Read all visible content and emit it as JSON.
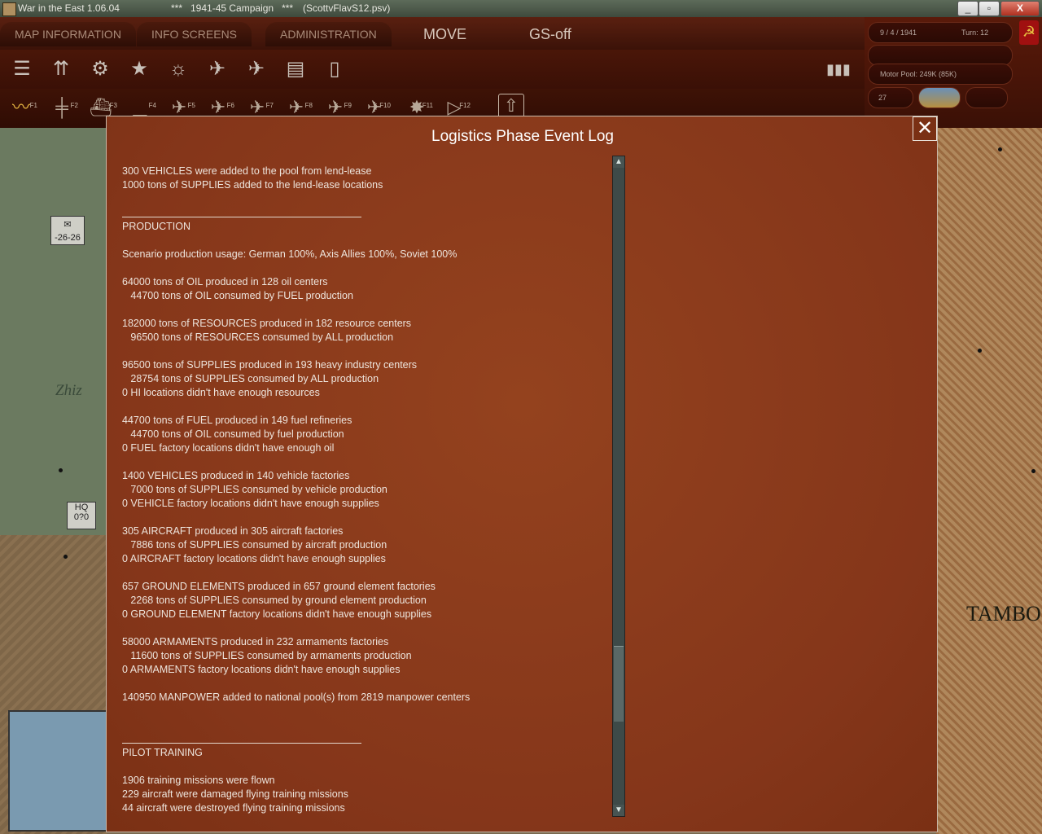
{
  "window": {
    "app_title": "War in the East 1.06.04",
    "campaign": "***   1941-45 Campaign   ***",
    "file": "(ScottvFlavS12.psv)",
    "min": "_",
    "max": "▫",
    "close": "X"
  },
  "menu": {
    "tabs": [
      "MAP INFORMATION",
      "INFO SCREENS",
      "ADMINISTRATION"
    ],
    "move": "MOVE",
    "gs": "GS-off"
  },
  "fkeys": [
    "F1",
    "F2",
    "F3",
    "F4",
    "F5",
    "F6",
    "F7",
    "F8",
    "F9",
    "F10",
    "F11",
    "F12"
  ],
  "info": {
    "date": "9 / 4 / 1941",
    "turn": "Turn: 12",
    "motor_pool": "Motor Pool: 249K (85K)",
    "value": "27"
  },
  "map": {
    "place_left": "Zhiz",
    "place_right": "TAMBO",
    "counter1": "-26-26",
    "hq_label": "HQ",
    "hq_value": "0?0"
  },
  "dialog": {
    "title": "Logistics Phase Event Log",
    "close": "✕",
    "lines": [
      "300 VEHICLES were added to the pool from lend-lease",
      "1000 tons of SUPPLIES added to the lend-lease locations",
      "PRODUCTION",
      "Scenario production usage: German 100%, Axis Allies 100%, Soviet 100%",
      "64000 tons of OIL produced in 128 oil centers",
      "   44700 tons of OIL consumed by FUEL production",
      "182000 tons of RESOURCES produced in 182 resource centers",
      "   96500 tons of RESOURCES consumed by ALL production",
      "96500 tons of SUPPLIES produced in 193 heavy industry centers",
      "   28754 tons of SUPPLIES consumed by ALL production",
      "0 HI locations didn't have enough resources",
      "44700 tons of FUEL produced in 149 fuel refineries",
      "   44700 tons of OIL consumed by fuel production",
      "0 FUEL factory locations didn't have enough oil",
      "1400 VEHICLES produced in 140 vehicle factories",
      "   7000 tons of SUPPLIES consumed by vehicle production",
      "0 VEHICLE factory locations didn't have enough supplies",
      "305 AIRCRAFT produced in 305 aircraft factories",
      "   7886 tons of SUPPLIES consumed by aircraft production",
      "0 AIRCRAFT factory locations didn't have enough supplies",
      "657 GROUND ELEMENTS produced in 657 ground element factories",
      "   2268 tons of SUPPLIES consumed by ground element production",
      "0 GROUND ELEMENT factory locations didn't have enough supplies",
      "58000 ARMAMENTS produced in 232 armaments factories",
      "   11600 tons of SUPPLIES consumed by armaments production",
      "0 ARMAMENTS factory locations didn't have enough supplies",
      "140950 MANPOWER added to national pool(s) from 2819 manpower centers",
      "PILOT TRAINING",
      "1906 training missions were flown",
      "229 aircraft were damaged flying training missions",
      "44 aircraft were destroyed flying training missions"
    ]
  },
  "scroll_position": 0.85
}
